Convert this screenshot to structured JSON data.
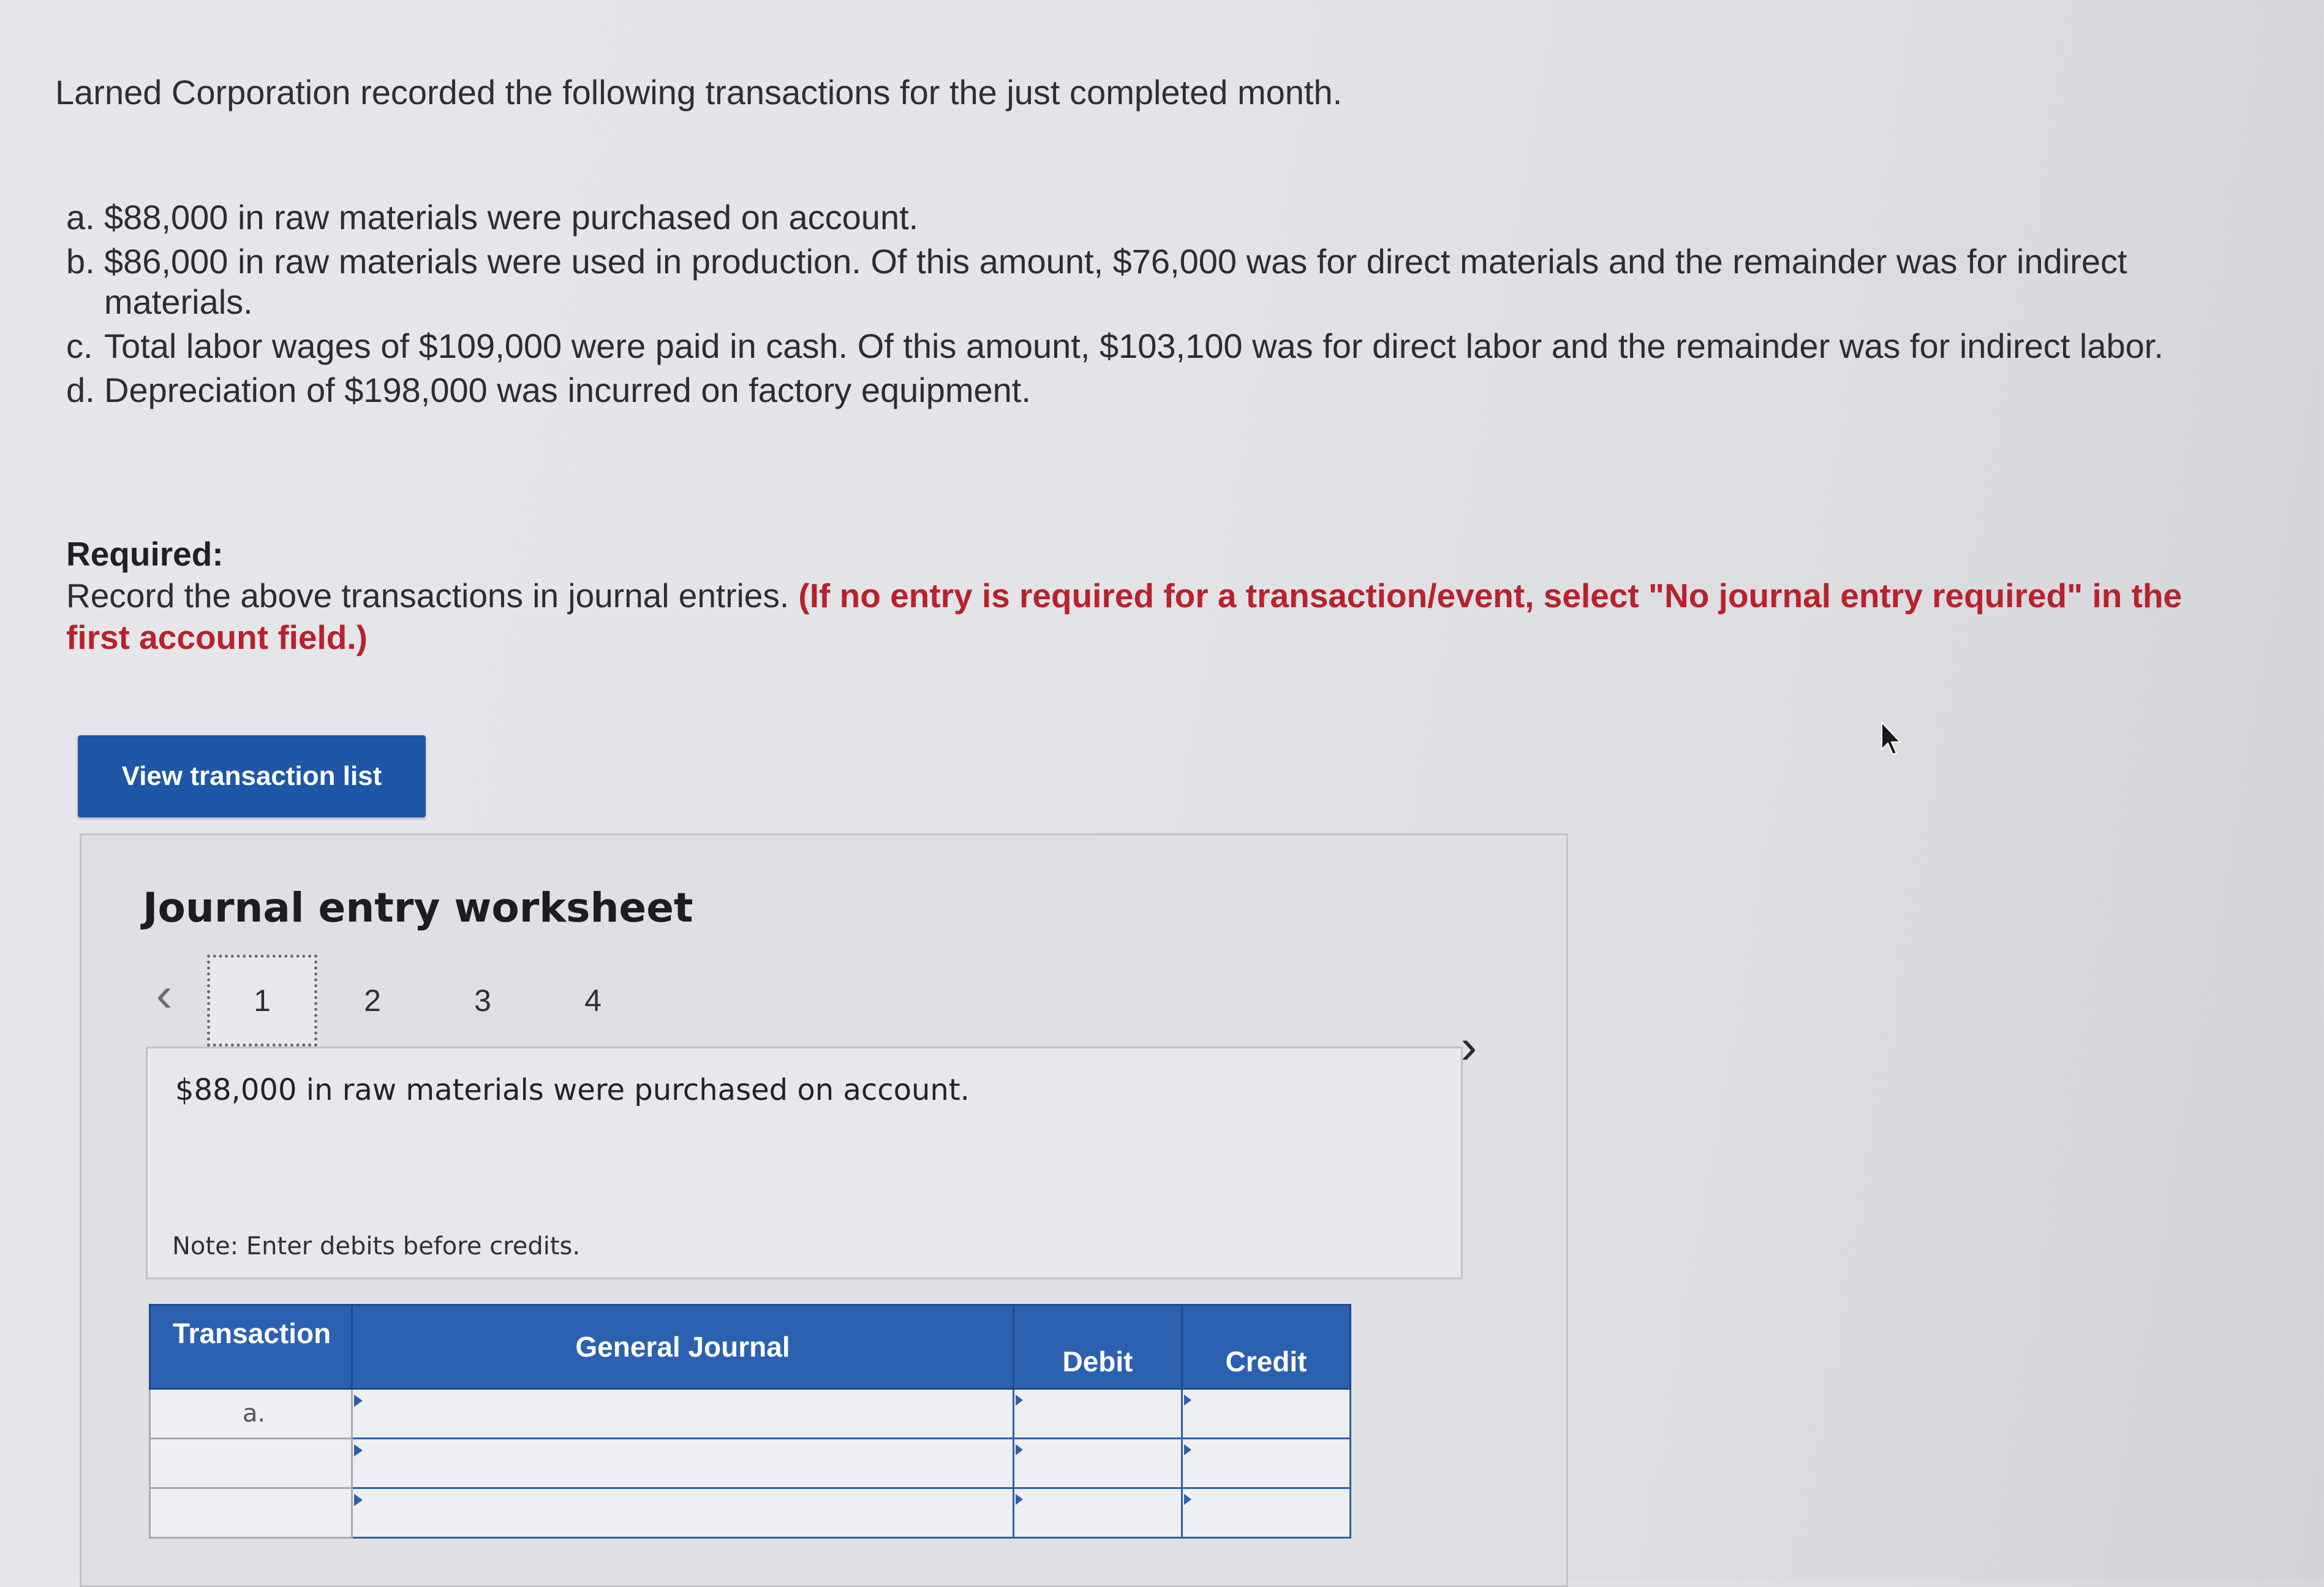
{
  "problem": {
    "intro": "Larned Corporation recorded the following transactions for the just completed month.",
    "transactions": [
      {
        "letter": "a.",
        "text": "$88,000 in raw materials were purchased on account."
      },
      {
        "letter": "b.",
        "text": "$86,000 in raw materials were used in production. Of this amount, $76,000 was for direct materials and the remainder was for indirect materials."
      },
      {
        "letter": "c.",
        "text": "Total labor wages of $109,000 were paid in cash. Of this amount, $103,100 was for direct labor and the remainder was for indirect labor."
      },
      {
        "letter": "d.",
        "text": "Depreciation of $198,000 was incurred on factory equipment."
      }
    ],
    "required_heading": "Required:",
    "required_text": "Record the above transactions in journal entries.",
    "required_instruction": "(If no entry is required for a transaction/event, select \"No journal entry required\" in the first account field.)"
  },
  "buttons": {
    "view_transaction_list": "View transaction list"
  },
  "worksheet": {
    "title": "Journal entry worksheet",
    "pages": [
      "1",
      "2",
      "3",
      "4"
    ],
    "active_page": "1",
    "prev_glyph": "‹",
    "next_glyph": "›",
    "description": "$88,000 in raw materials were purchased on account.",
    "note": "Note: Enter debits before credits.",
    "table": {
      "headers": {
        "transaction": "Transaction",
        "general_journal": "General Journal",
        "debit": "Debit",
        "credit": "Credit"
      },
      "rows": [
        {
          "transaction": "a.",
          "account": "",
          "debit": "",
          "credit": ""
        },
        {
          "transaction": "",
          "account": "",
          "debit": "",
          "credit": ""
        },
        {
          "transaction": "",
          "account": "",
          "debit": "",
          "credit": ""
        }
      ]
    }
  },
  "colors": {
    "accent_blue": "#1e56a8",
    "table_header_blue": "#2c60b0",
    "instruction_red": "#b8222c"
  }
}
